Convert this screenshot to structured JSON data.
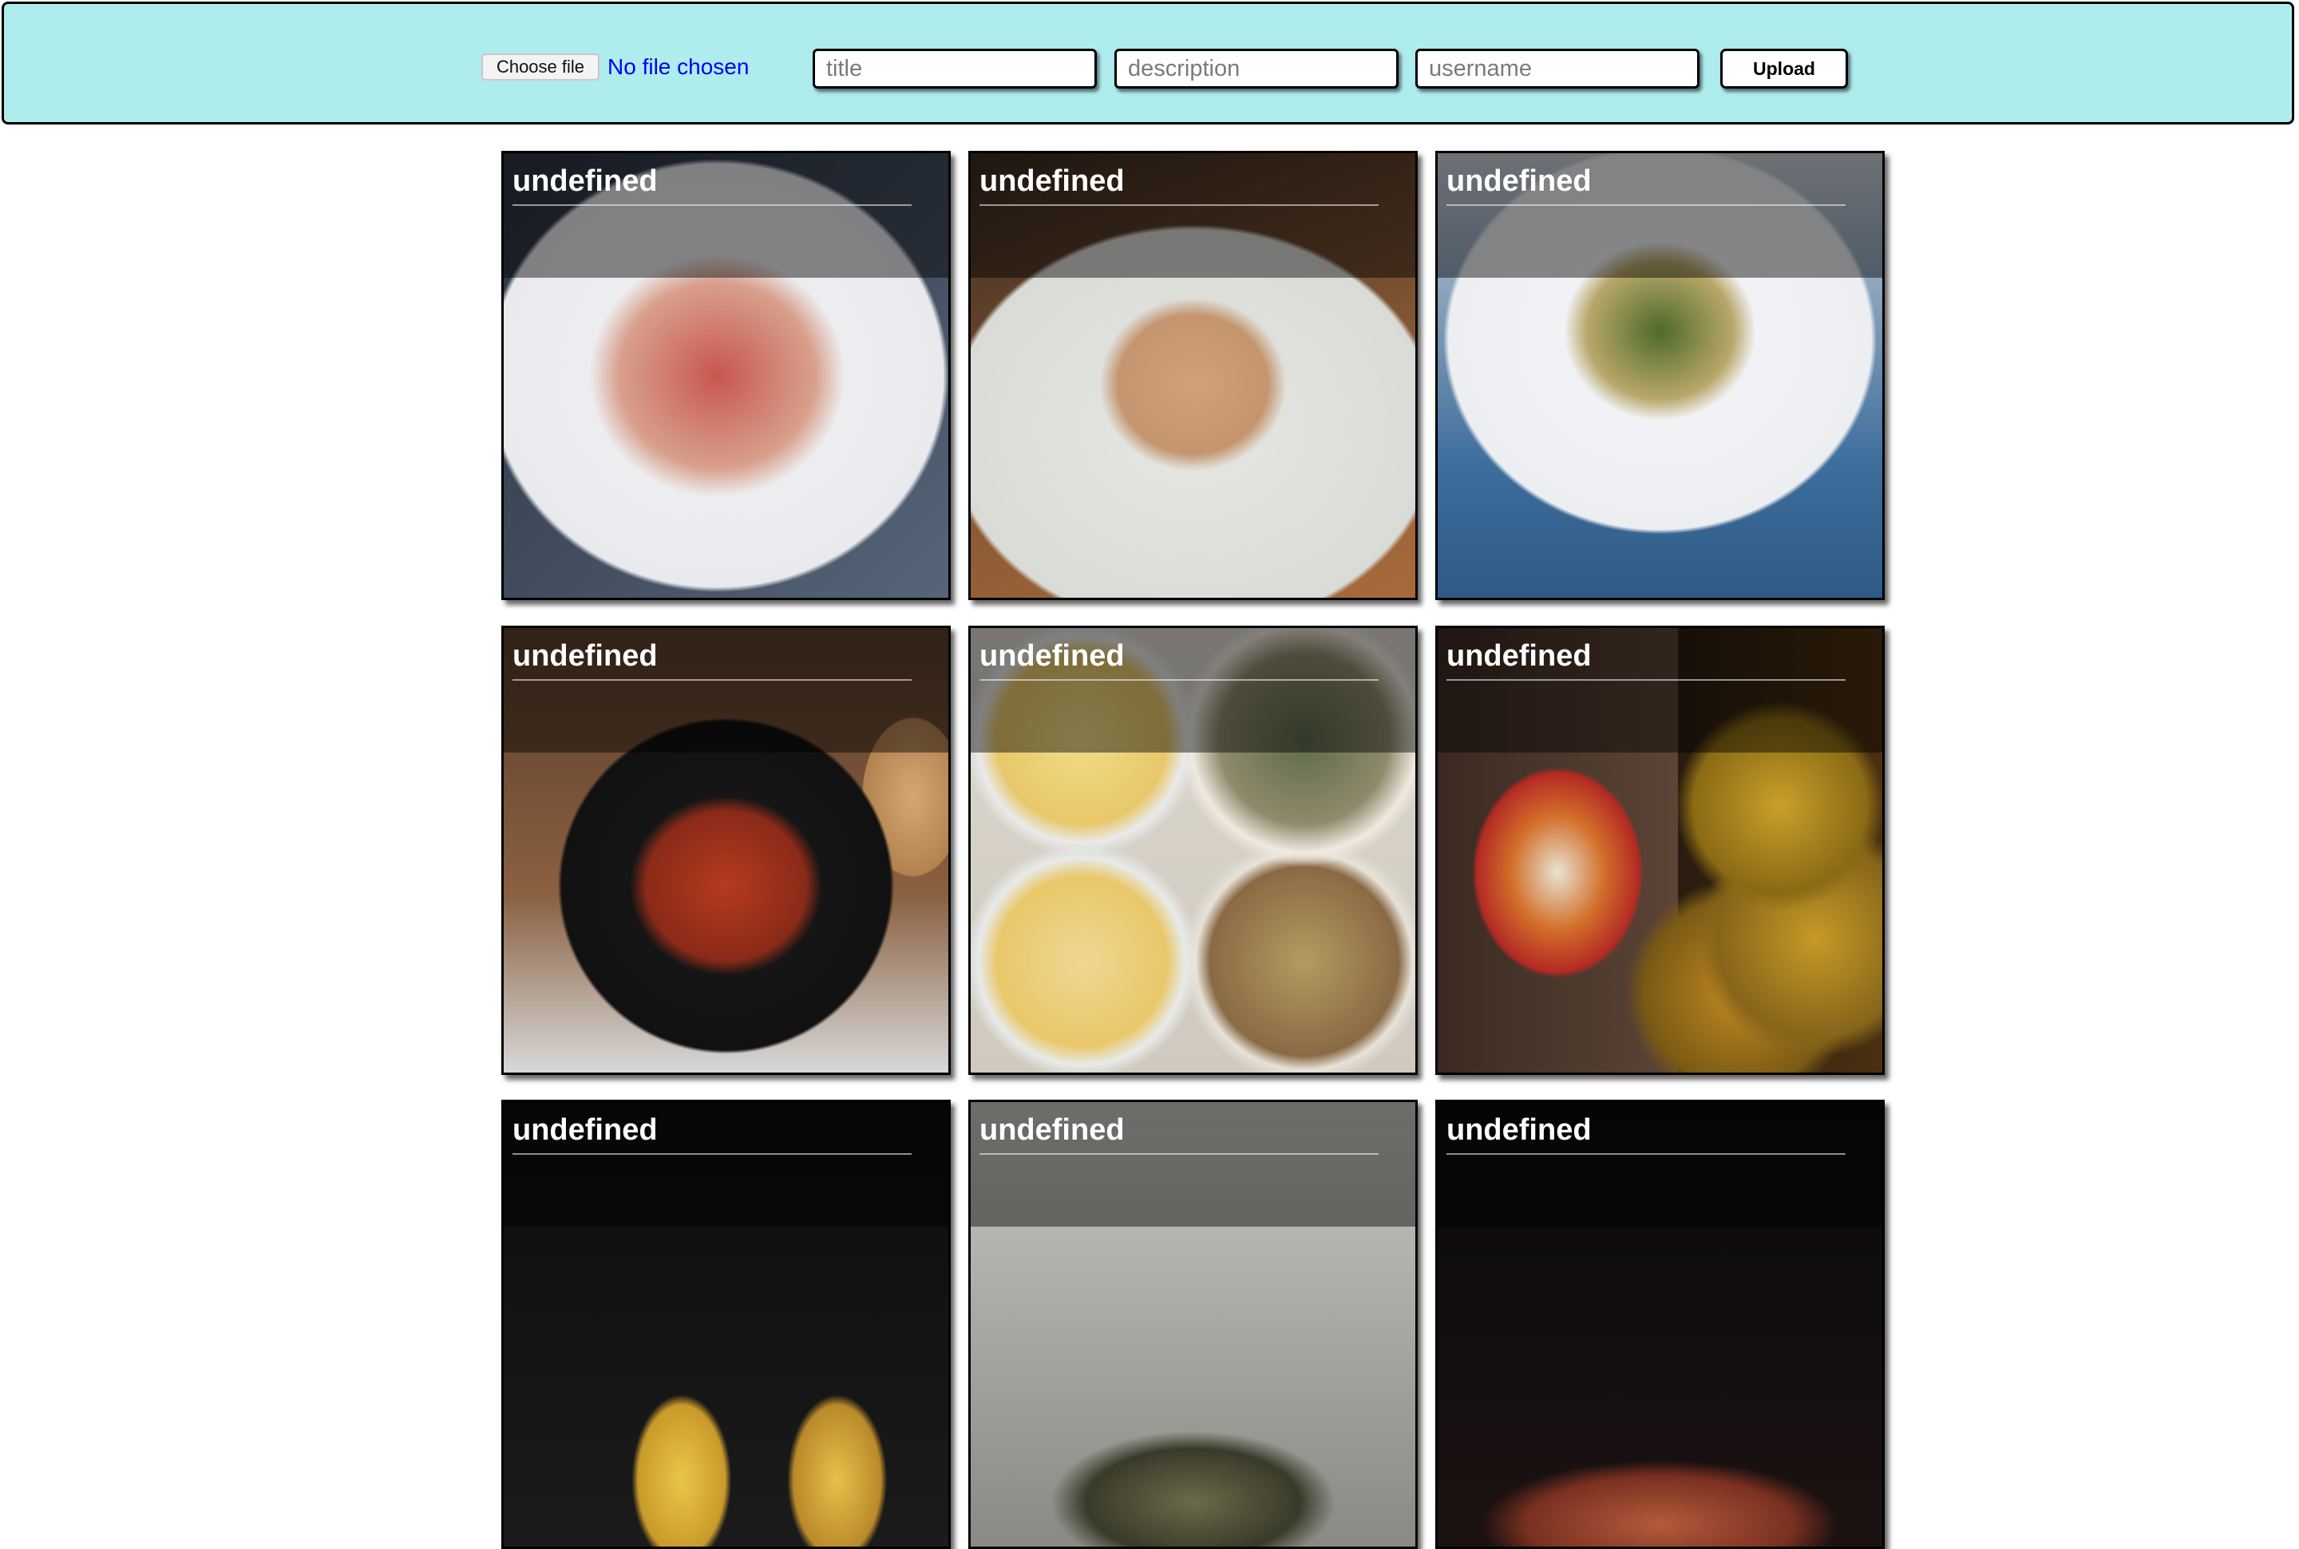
{
  "upload_form": {
    "file_button_label": "Choose file",
    "file_status": "No file chosen",
    "title_placeholder": "title",
    "description_placeholder": "description",
    "username_placeholder": "username",
    "upload_label": "Upload"
  },
  "gallery": {
    "cards": [
      {
        "label": "undefined",
        "photo": "spaghetti with tomato sauce and grated cheese on floral plate"
      },
      {
        "label": "undefined",
        "photo": "tongs serving plain spaghetti on white plate"
      },
      {
        "label": "undefined",
        "photo": "orzo with greens on floral plate"
      },
      {
        "label": "undefined",
        "photo": "fish in tomato sauce in cast iron pan"
      },
      {
        "label": "undefined",
        "photo": "collage of apple tart preparation"
      },
      {
        "label": "undefined",
        "photo": "shakshuka and tomatoes collage"
      },
      {
        "label": "undefined",
        "photo": "corn on the cob"
      },
      {
        "label": "undefined",
        "photo": "pasta with herbs"
      },
      {
        "label": "undefined",
        "photo": "tongs over rice dish"
      }
    ]
  },
  "colors": {
    "toolbar_background": "#aeecee",
    "link_blue": "#0000ee"
  }
}
